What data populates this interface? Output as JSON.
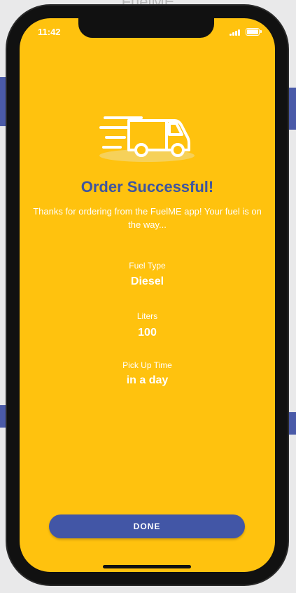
{
  "status_bar": {
    "time": "11:42"
  },
  "order": {
    "title": "Order Successful!",
    "message": "Thanks for ordering from the FuelME app! Your fuel is on the way...",
    "fuel_type_label": "Fuel Type",
    "fuel_type_value": "Diesel",
    "liters_label": "Liters",
    "liters_value": "100",
    "pickup_label": "Pick Up Time",
    "pickup_value": "in a day",
    "done_label": "DONE"
  },
  "icons": {
    "illustration": "delivery-truck-icon"
  },
  "colors": {
    "background": "#ffc20e",
    "title": "#3e55a0",
    "button": "#4256a6",
    "text": "#ffffff"
  }
}
